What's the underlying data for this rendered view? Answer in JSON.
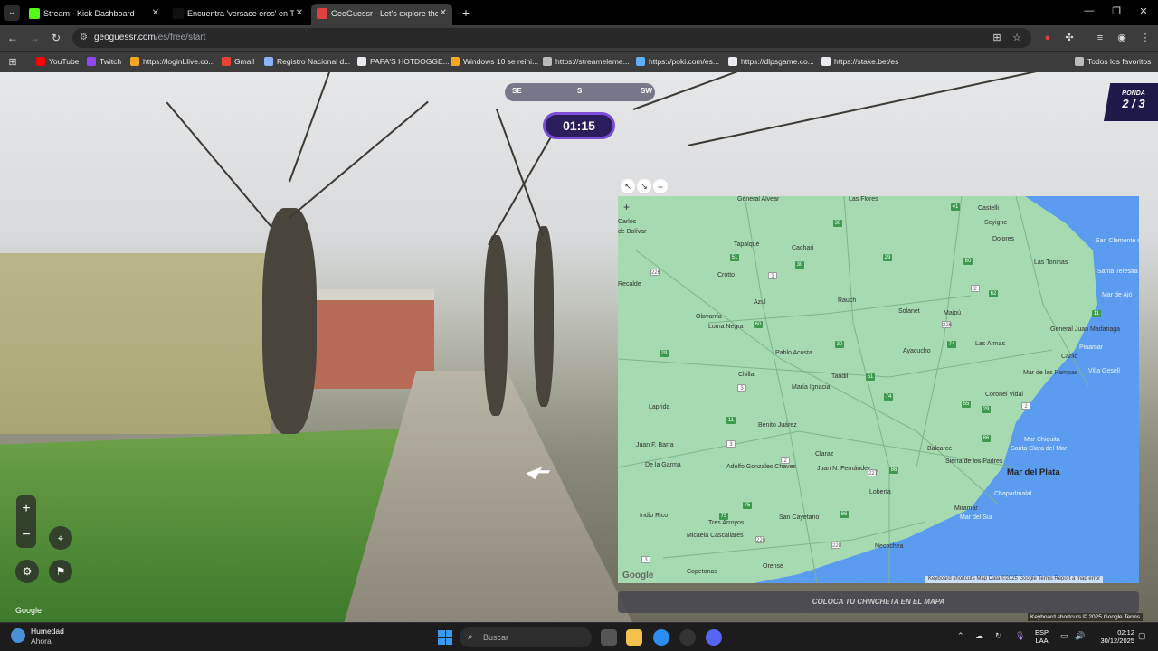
{
  "browser": {
    "tabs": [
      {
        "title": "Stream - Kick Dashboard",
        "favicon_color": "#53fc18",
        "active": false
      },
      {
        "title": "Encuentra 'versace eros' en Tik",
        "favicon_color": "#111111",
        "active": false
      },
      {
        "title": "GeoGuessr - Let's explore the w",
        "favicon_color": "#e24040",
        "active": true
      }
    ],
    "tab_close_glyph": "✕",
    "new_tab_glyph": "+",
    "url_host": "geoguessr.com",
    "url_path": "/es/free/start",
    "bookmarks": [
      {
        "label": "YouTube",
        "color": "#ff0000"
      },
      {
        "label": "Twitch",
        "color": "#9146ff"
      },
      {
        "label": "https://loginLlive.co...",
        "color": "#f5a623"
      },
      {
        "label": "Gmail",
        "color": "#ea4335"
      },
      {
        "label": "Registro Nacional d...",
        "color": "#8ab4f8"
      },
      {
        "label": "PAPA'S HOTDOGGE...",
        "color": "#e8eaed"
      },
      {
        "label": "Windows 10 se reini...",
        "color": "#f5a623"
      },
      {
        "label": "https://streameleme...",
        "color": "#bbbbbb"
      },
      {
        "label": "https://poki.com/es...",
        "color": "#5fb0ff"
      },
      {
        "label": "https://dlpsgame.co...",
        "color": "#e8eaed"
      },
      {
        "label": "https://stake.bet/es",
        "color": "#e8eaed"
      }
    ],
    "all_bookmarks_label": "Todos los favoritos"
  },
  "game": {
    "compass": {
      "left": "SE",
      "center": "S",
      "right": "SW"
    },
    "timer": "01:15",
    "round_label": "RONDA",
    "round_value": "2 / 3",
    "zoom_in": "+",
    "zoom_out": "−",
    "google_watermark": "Google",
    "place_pin_label": "COLOCA TU CHINCHETA EN EL MAPA",
    "sv_footer": "Keyboard shortcuts   © 2025 Google   Terms",
    "map": {
      "plus": "+",
      "google_logo": "Google",
      "footer": "Keyboard shortcuts    Map Data ©2025 Google    Terms    Report a map error",
      "cities": [
        {
          "name": "General Alvear",
          "class": "city"
        },
        {
          "name": "Las Flores",
          "class": "city"
        },
        {
          "name": "Castelli",
          "class": "city"
        },
        {
          "name": "Carlos",
          "class": "city"
        },
        {
          "name": "de Bolívar",
          "class": "city"
        },
        {
          "name": "Seyigne",
          "class": "city"
        },
        {
          "name": "Dolores",
          "class": "city"
        },
        {
          "name": "San Clemente del Tuyú",
          "class": "city ocean-lbl"
        },
        {
          "name": "Tapalqué",
          "class": "city"
        },
        {
          "name": "Cachari",
          "class": "city"
        },
        {
          "name": "Las Toninas",
          "class": "city"
        },
        {
          "name": "Crotto",
          "class": "city"
        },
        {
          "name": "Santa Teresita",
          "class": "city ocean-lbl"
        },
        {
          "name": "Recalde",
          "class": "city"
        },
        {
          "name": "Azul",
          "class": "city"
        },
        {
          "name": "Rauch",
          "class": "city"
        },
        {
          "name": "Mar de Ajó",
          "class": "city ocean-lbl"
        },
        {
          "name": "Solanet",
          "class": "city"
        },
        {
          "name": "Maipú",
          "class": "city"
        },
        {
          "name": "Olavarría",
          "class": "city"
        },
        {
          "name": "Loma Negra",
          "class": "city"
        },
        {
          "name": "General Juan Madariaga",
          "class": "city"
        },
        {
          "name": "Las Armas",
          "class": "city"
        },
        {
          "name": "Pinamar",
          "class": "city ocean-lbl"
        },
        {
          "name": "Pablo Acosta",
          "class": "city"
        },
        {
          "name": "Ayacucho",
          "class": "city"
        },
        {
          "name": "Cariló",
          "class": "city"
        },
        {
          "name": "Villa Gesell",
          "class": "city ocean-lbl"
        },
        {
          "name": "Chillar",
          "class": "city"
        },
        {
          "name": "Tandil",
          "class": "city"
        },
        {
          "name": "Mar de las Pampas",
          "class": "city"
        },
        {
          "name": "María Ignacia",
          "class": "city"
        },
        {
          "name": "Coronel Vidal",
          "class": "city"
        },
        {
          "name": "Laprida",
          "class": "city"
        },
        {
          "name": "Benito Juárez",
          "class": "city"
        },
        {
          "name": "Mar Chiquita",
          "class": "city ocean-lbl"
        },
        {
          "name": "Santa Clara del Mar",
          "class": "city ocean-lbl"
        },
        {
          "name": "Juan F. Barra",
          "class": "city"
        },
        {
          "name": "Balcarce",
          "class": "city"
        },
        {
          "name": "Sierra de los Padres",
          "class": "city"
        },
        {
          "name": "Mar del Plata",
          "class": "city big"
        },
        {
          "name": "Claraz",
          "class": "city"
        },
        {
          "name": "De la Garma",
          "class": "city"
        },
        {
          "name": "Juan N. Fernández",
          "class": "city"
        },
        {
          "name": "Adolfo Gonzales Chaves",
          "class": "city"
        },
        {
          "name": "Lobería",
          "class": "city"
        },
        {
          "name": "Chapadmalal",
          "class": "city ocean-lbl"
        },
        {
          "name": "Miramar",
          "class": "city"
        },
        {
          "name": "Mar del Sur",
          "class": "city ocean-lbl"
        },
        {
          "name": "Indio Rico",
          "class": "city"
        },
        {
          "name": "Tres Arroyos",
          "class": "city"
        },
        {
          "name": "San Cayetano",
          "class": "city"
        },
        {
          "name": "Micaela Cascallares",
          "class": "city"
        },
        {
          "name": "Necochea",
          "class": "city"
        },
        {
          "name": "Orense",
          "class": "city"
        },
        {
          "name": "Copetonas",
          "class": "city"
        }
      ],
      "routes": [
        "30",
        "41",
        "51",
        "30",
        "3",
        "29",
        "60",
        "2",
        "62",
        "226",
        "60",
        "226",
        "11",
        "30",
        "74",
        "29",
        "51",
        "74",
        "3",
        "29",
        "55",
        "2",
        "11",
        "86",
        "3",
        "2",
        "86",
        "227",
        "75",
        "75",
        "86",
        "228",
        "228",
        "3"
      ]
    }
  },
  "taskbar": {
    "weather_title": "Humedad",
    "weather_sub": "Ahora",
    "weather_badge": "2",
    "search_placeholder": "Buscar",
    "lang_top": "ESP",
    "lang_bottom": "LAA",
    "time": "02:12",
    "date": "30/12/2025"
  }
}
